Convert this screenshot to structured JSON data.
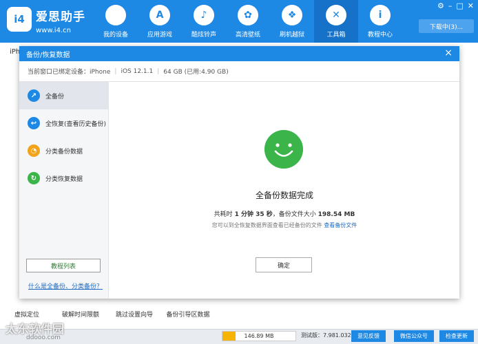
{
  "app": {
    "logo_text": "i4",
    "name": "爱思助手",
    "url": "www.i4.cn"
  },
  "nav": [
    {
      "label": "我的设备",
      "icon": "apple-icon",
      "glyph": ""
    },
    {
      "label": "应用游戏",
      "icon": "appstore-icon",
      "glyph": "A"
    },
    {
      "label": "酷炫铃声",
      "icon": "bell-icon",
      "glyph": "♪"
    },
    {
      "label": "高清壁纸",
      "icon": "flower-icon",
      "glyph": "✿"
    },
    {
      "label": "刷机越狱",
      "icon": "dropbox-icon",
      "glyph": "❖"
    },
    {
      "label": "工具箱",
      "icon": "tools-icon",
      "glyph": "✕"
    },
    {
      "label": "教程中心",
      "icon": "info-icon",
      "glyph": "i"
    }
  ],
  "window_controls": {
    "settings": "⚙",
    "minimize": "–",
    "restore": "□",
    "close": "✕"
  },
  "download_button": "下载中(3)...",
  "bg_tab": "iPh",
  "bg_tools": [
    "虚拟定位",
    "破解时间限额",
    "跳过设置向导",
    "备份引导区数据"
  ],
  "modal": {
    "title": "备份/恢复数据",
    "close": "×",
    "device_info": {
      "binding": "当前窗口已绑定设备：iPhone",
      "ios": "iOS 12.1.1",
      "storage": "64 GB (已用:4.90 GB)"
    },
    "sidebar": [
      {
        "label": "全备份",
        "icon": "arrow-share-icon",
        "glyph": "↗",
        "color": "#1e88e5",
        "active": true
      },
      {
        "label": "全恢复(查看历史备份)",
        "icon": "arrow-back-icon",
        "glyph": "↩",
        "color": "#1e88e5",
        "active": false
      },
      {
        "label": "分类备份数据",
        "icon": "category-backup-icon",
        "glyph": "◔",
        "color": "#f2a31b",
        "active": false
      },
      {
        "label": "分类恢复数据",
        "icon": "category-restore-icon",
        "glyph": "↻",
        "color": "#3bb54a",
        "active": false
      }
    ],
    "tutorial_button": "教程列表",
    "help_link": "什么是全备份、分类备份？",
    "result": {
      "title": "全备份数据完成",
      "stats_prefix": "共耗时",
      "duration": "1 分钟 35 秒",
      "stats_mid": "，备份文件大小",
      "size": "198.54 MB",
      "hint": "您可以到全恢复数据界面查看已经备份的文件",
      "hint_link": "查看备份文件",
      "ok_button": "确定"
    }
  },
  "statusbar": {
    "watermark": "太东软件园",
    "watermark_sub": "ddooo.com",
    "storage_text": "146.89 MB",
    "storage_fill": 0.18,
    "version": "测试版：7.981.032",
    "feedback": "意见反馈",
    "wechat": "微信公众号",
    "update": "检查更新"
  },
  "colors": {
    "primary": "#1e88e5",
    "success": "#3bb54a",
    "warning": "#f6b400"
  }
}
